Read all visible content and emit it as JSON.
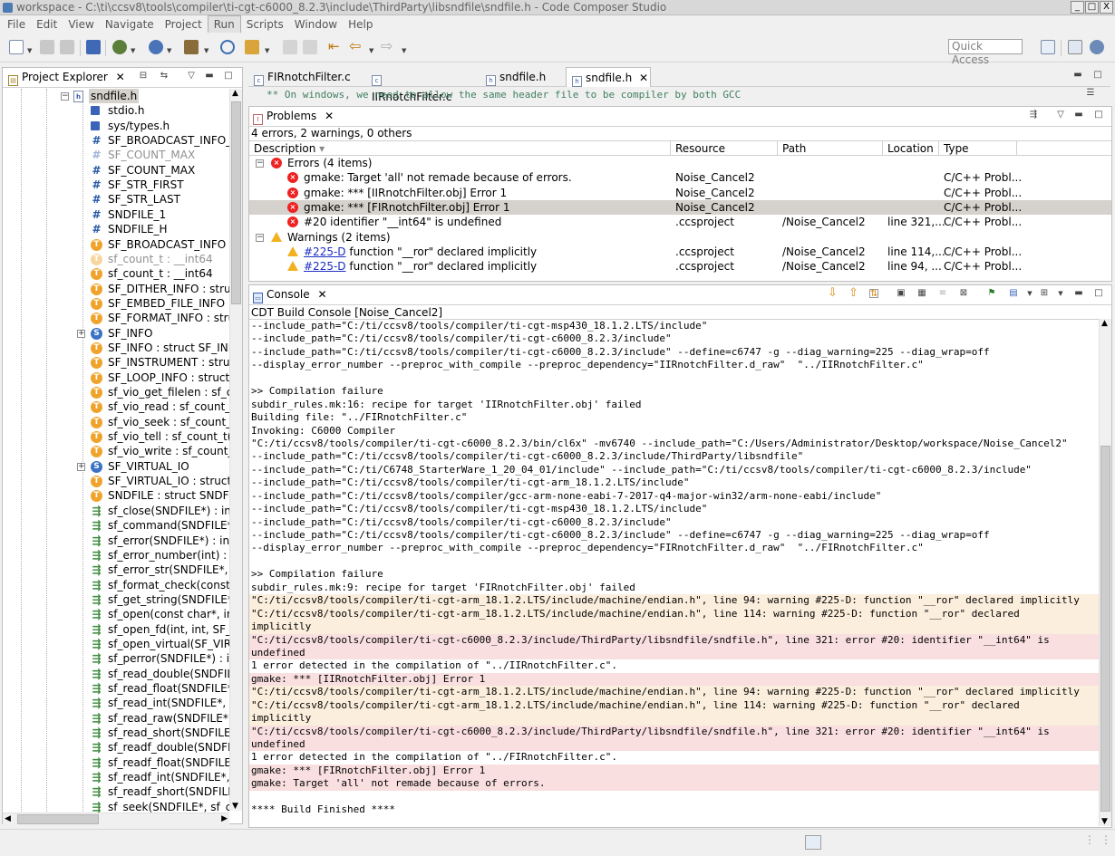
{
  "window": {
    "title": "workspace - C:\\ti\\ccsv8\\tools\\compiler\\ti-cgt-c6000_8.2.3\\include\\ThirdParty\\libsndfile\\sndfile.h - Code Composer Studio",
    "controls": [
      "_",
      "□",
      "X"
    ]
  },
  "menubar": {
    "items": [
      "File",
      "Edit",
      "View",
      "Navigate",
      "Project",
      "Run",
      "Scripts",
      "Window",
      "Help"
    ]
  },
  "toolbar": {
    "quick_access_placeholder": "Quick Access"
  },
  "project_explorer": {
    "title": "Project Explorer",
    "close": "✕",
    "items": [
      {
        "label": "sndfile.h",
        "icon": "header-file-icon",
        "indent": 0,
        "expander": "⊟",
        "selected": true
      },
      {
        "label": "stdio.h",
        "icon": "include-icon",
        "indent": 1
      },
      {
        "label": "sys/types.h",
        "icon": "include-icon",
        "indent": 1
      },
      {
        "label": "SF_BROADCAST_INFO_V",
        "icon": "macro-icon",
        "indent": 1
      },
      {
        "label": "SF_COUNT_MAX",
        "icon": "macro-icon",
        "indent": 1,
        "muted": true
      },
      {
        "label": "SF_COUNT_MAX",
        "icon": "macro-icon",
        "indent": 1
      },
      {
        "label": "SF_STR_FIRST",
        "icon": "macro-icon",
        "indent": 1
      },
      {
        "label": "SF_STR_LAST",
        "icon": "macro-icon",
        "indent": 1
      },
      {
        "label": "SNDFILE_1",
        "icon": "macro-icon",
        "indent": 1
      },
      {
        "label": "SNDFILE_H",
        "icon": "macro-icon",
        "indent": 1
      },
      {
        "label": "SF_BROADCAST_INFO :",
        "icon": "typedef-icon",
        "indent": 1
      },
      {
        "label": "sf_count_t : __int64",
        "icon": "typedef-icon",
        "indent": 1,
        "muted": true
      },
      {
        "label": "sf_count_t : __int64",
        "icon": "typedef-icon",
        "indent": 1
      },
      {
        "label": "SF_DITHER_INFO : struc",
        "icon": "typedef-icon",
        "indent": 1
      },
      {
        "label": "SF_EMBED_FILE_INFO :",
        "icon": "typedef-icon",
        "indent": 1
      },
      {
        "label": "SF_FORMAT_INFO : stru",
        "icon": "typedef-icon",
        "indent": 1
      },
      {
        "label": "SF_INFO",
        "icon": "struct-icon",
        "indent": 1,
        "expander": "⊞"
      },
      {
        "label": "SF_INFO : struct SF_INF",
        "icon": "typedef-icon",
        "indent": 1
      },
      {
        "label": "SF_INSTRUMENT : struc",
        "icon": "typedef-icon",
        "indent": 1
      },
      {
        "label": "SF_LOOP_INFO : struct",
        "icon": "typedef-icon",
        "indent": 1
      },
      {
        "label": "sf_vio_get_filelen : sf_co",
        "icon": "typedef-icon",
        "indent": 1
      },
      {
        "label": "sf_vio_read : sf_count_t(",
        "icon": "typedef-icon",
        "indent": 1
      },
      {
        "label": "sf_vio_seek : sf_count_t(",
        "icon": "typedef-icon",
        "indent": 1
      },
      {
        "label": "sf_vio_tell : sf_count_t(*)",
        "icon": "typedef-icon",
        "indent": 1
      },
      {
        "label": "sf_vio_write : sf_count_t(",
        "icon": "typedef-icon",
        "indent": 1
      },
      {
        "label": "SF_VIRTUAL_IO",
        "icon": "struct-icon",
        "indent": 1,
        "expander": "⊞"
      },
      {
        "label": "SF_VIRTUAL_IO : struct S",
        "icon": "typedef-icon",
        "indent": 1
      },
      {
        "label": "SNDFILE : struct SNDFIL",
        "icon": "typedef-icon",
        "indent": 1
      },
      {
        "label": "sf_close(SNDFILE*) : int",
        "icon": "function-icon",
        "indent": 1
      },
      {
        "label": "sf_command(SNDFILE*,",
        "icon": "function-icon",
        "indent": 1
      },
      {
        "label": "sf_error(SNDFILE*) : int",
        "icon": "function-icon",
        "indent": 1
      },
      {
        "label": "sf_error_number(int) : co",
        "icon": "function-icon",
        "indent": 1
      },
      {
        "label": "sf_error_str(SNDFILE*, c",
        "icon": "function-icon",
        "indent": 1
      },
      {
        "label": "sf_format_check(const S",
        "icon": "function-icon",
        "indent": 1
      },
      {
        "label": "sf_get_string(SNDFILE*,",
        "icon": "function-icon",
        "indent": 1
      },
      {
        "label": "sf_open(const char*, int,",
        "icon": "function-icon",
        "indent": 1
      },
      {
        "label": "sf_open_fd(int, int, SF_IN",
        "icon": "function-icon",
        "indent": 1
      },
      {
        "label": "sf_open_virtual(SF_VIRTU",
        "icon": "function-icon",
        "indent": 1
      },
      {
        "label": "sf_perror(SNDFILE*) : in",
        "icon": "function-icon",
        "indent": 1
      },
      {
        "label": "sf_read_double(SNDFILE",
        "icon": "function-icon",
        "indent": 1
      },
      {
        "label": "sf_read_float(SNDFILE*,",
        "icon": "function-icon",
        "indent": 1
      },
      {
        "label": "sf_read_int(SNDFILE*, in",
        "icon": "function-icon",
        "indent": 1
      },
      {
        "label": "sf_read_raw(SNDFILE*, v",
        "icon": "function-icon",
        "indent": 1
      },
      {
        "label": "sf_read_short(SNDFILE*,",
        "icon": "function-icon",
        "indent": 1
      },
      {
        "label": "sf_readf_double(SNDFILE",
        "icon": "function-icon",
        "indent": 1
      },
      {
        "label": "sf_readf_float(SNDFILE*,",
        "icon": "function-icon",
        "indent": 1
      },
      {
        "label": "sf_readf_int(SNDFILE*, in",
        "icon": "function-icon",
        "indent": 1
      },
      {
        "label": "sf_readf_short(SNDFILE*",
        "icon": "function-icon",
        "indent": 1
      },
      {
        "label": "sf_seek(SNDFILE*, sf_co",
        "icon": "function-icon",
        "indent": 1
      }
    ]
  },
  "editor": {
    "tabs": [
      {
        "label": "FIRnotchFilter.c",
        "icon": "c-file-icon",
        "active": false
      },
      {
        "label": "IIRnotchFilter.c",
        "icon": "c-file-icon",
        "active": false
      },
      {
        "label": "sndfile.h",
        "icon": "header-file-icon",
        "active": false
      },
      {
        "label": "sndfile.h",
        "icon": "header-file-icon",
        "active": true,
        "close": "✕"
      }
    ],
    "visible_line": "** On windows, we need to allow the same header file to be compiler by both GCC"
  },
  "problems": {
    "title": "Problems",
    "close": "✕",
    "summary": "4 errors, 2 warnings, 0 others",
    "columns": [
      "Description",
      "Resource",
      "Path",
      "Location",
      "Type"
    ],
    "sort_indicator": "▾",
    "groups": [
      {
        "label": "Errors (4 items)",
        "kind": "error",
        "rows": [
          {
            "desc_link": "",
            "desc": "gmake: Target 'all' not remade because of errors.",
            "resource": "Noise_Cancel2",
            "path": "",
            "location": "",
            "type": "C/C++ Probl..."
          },
          {
            "desc_link": "",
            "desc": "gmake: *** [IIRnotchFilter.obj] Error 1",
            "resource": "Noise_Cancel2",
            "path": "",
            "location": "",
            "type": "C/C++ Probl..."
          },
          {
            "desc_link": "",
            "desc": "gmake: *** [FIRnotchFilter.obj] Error 1",
            "resource": "Noise_Cancel2",
            "path": "",
            "location": "",
            "type": "C/C++ Probl...",
            "selected": true
          },
          {
            "desc_link": "",
            "desc": "#20 identifier \"__int64\" is undefined",
            "resource": ".ccsproject",
            "path": "/Noise_Cancel2",
            "location": "line 321,...",
            "type": "C/C++ Probl..."
          }
        ]
      },
      {
        "label": "Warnings (2 items)",
        "kind": "warning",
        "rows": [
          {
            "desc_link": "#225-D",
            "desc": " function \"__ror\" declared implicitly",
            "resource": ".ccsproject",
            "path": "/Noise_Cancel2",
            "location": "line 114,...",
            "type": "C/C++ Probl..."
          },
          {
            "desc_link": "#225-D",
            "desc": " function \"__ror\" declared implicitly",
            "resource": ".ccsproject",
            "path": "/Noise_Cancel2",
            "location": "line 94, ...",
            "type": "C/C++ Probl..."
          }
        ]
      }
    ]
  },
  "console": {
    "title": "Console",
    "close": "✕",
    "subtitle": "CDT Build Console [Noise_Cancel2]",
    "lines": [
      {
        "text": "--include_path=\"C:/ti/ccsv8/tools/compiler/ti-cgt-msp430_18.1.2.LTS/include\"",
        "kind": "normal"
      },
      {
        "text": "--include_path=\"C:/ti/ccsv8/tools/compiler/ti-cgt-c6000_8.2.3/include\"",
        "kind": "normal"
      },
      {
        "text": "--include_path=\"C:/ti/ccsv8/tools/compiler/ti-cgt-c6000_8.2.3/include\" --define=c6747 -g --diag_warning=225 --diag_wrap=off",
        "kind": "normal"
      },
      {
        "text": "--display_error_number --preproc_with_compile --preproc_dependency=\"IIRnotchFilter.d_raw\"  \"../IIRnotchFilter.c\"",
        "kind": "normal"
      },
      {
        "text": "",
        "kind": "normal"
      },
      {
        "text": ">> Compilation failure",
        "kind": "normal"
      },
      {
        "text": "subdir_rules.mk:16: recipe for target 'IIRnotchFilter.obj' failed",
        "kind": "normal"
      },
      {
        "text": "Building file: \"../FIRnotchFilter.c\"",
        "kind": "normal"
      },
      {
        "text": "Invoking: C6000 Compiler",
        "kind": "normal"
      },
      {
        "text": "\"C:/ti/ccsv8/tools/compiler/ti-cgt-c6000_8.2.3/bin/cl6x\" -mv6740 --include_path=\"C:/Users/Administrator/Desktop/workspace/Noise_Cancel2\"",
        "kind": "normal"
      },
      {
        "text": "--include_path=\"C:/ti/ccsv8/tools/compiler/ti-cgt-c6000_8.2.3/include/ThirdParty/libsndfile\"",
        "kind": "normal"
      },
      {
        "text": "--include_path=\"C:/ti/C6748_StarterWare_1_20_04_01/include\" --include_path=\"C:/ti/ccsv8/tools/compiler/ti-cgt-c6000_8.2.3/include\"",
        "kind": "normal"
      },
      {
        "text": "--include_path=\"C:/ti/ccsv8/tools/compiler/ti-cgt-arm_18.1.2.LTS/include\"",
        "kind": "normal"
      },
      {
        "text": "--include_path=\"C:/ti/ccsv8/tools/compiler/gcc-arm-none-eabi-7-2017-q4-major-win32/arm-none-eabi/include\"",
        "kind": "normal"
      },
      {
        "text": "--include_path=\"C:/ti/ccsv8/tools/compiler/ti-cgt-msp430_18.1.2.LTS/include\"",
        "kind": "normal"
      },
      {
        "text": "--include_path=\"C:/ti/ccsv8/tools/compiler/ti-cgt-c6000_8.2.3/include\"",
        "kind": "normal"
      },
      {
        "text": "--include_path=\"C:/ti/ccsv8/tools/compiler/ti-cgt-c6000_8.2.3/include\" --define=c6747 -g --diag_warning=225 --diag_wrap=off",
        "kind": "normal"
      },
      {
        "text": "--display_error_number --preproc_with_compile --preproc_dependency=\"FIRnotchFilter.d_raw\"  \"../FIRnotchFilter.c\"",
        "kind": "normal"
      },
      {
        "text": "",
        "kind": "normal"
      },
      {
        "text": ">> Compilation failure",
        "kind": "normal"
      },
      {
        "text": "subdir_rules.mk:9: recipe for target 'FIRnotchFilter.obj' failed",
        "kind": "normal"
      },
      {
        "text": "\"C:/ti/ccsv8/tools/compiler/ti-cgt-arm_18.1.2.LTS/include/machine/endian.h\", line 94: warning #225-D: function \"__ror\" declared implicitly",
        "kind": "warn"
      },
      {
        "text": "\"C:/ti/ccsv8/tools/compiler/ti-cgt-arm_18.1.2.LTS/include/machine/endian.h\", line 114: warning #225-D: function \"__ror\" declared",
        "kind": "warn"
      },
      {
        "text": "implicitly",
        "kind": "warn"
      },
      {
        "text": "\"C:/ti/ccsv8/tools/compiler/ti-cgt-c6000_8.2.3/include/ThirdParty/libsndfile/sndfile.h\", line 321: error #20: identifier \"__int64\" is",
        "kind": "err"
      },
      {
        "text": "undefined",
        "kind": "err"
      },
      {
        "text": "1 error detected in the compilation of \"../IIRnotchFilter.c\".",
        "kind": "normal"
      },
      {
        "text": "gmake: *** [IIRnotchFilter.obj] Error 1",
        "kind": "err"
      },
      {
        "text": "\"C:/ti/ccsv8/tools/compiler/ti-cgt-arm_18.1.2.LTS/include/machine/endian.h\", line 94: warning #225-D: function \"__ror\" declared implicitly",
        "kind": "warn"
      },
      {
        "text": "\"C:/ti/ccsv8/tools/compiler/ti-cgt-arm_18.1.2.LTS/include/machine/endian.h\", line 114: warning #225-D: function \"__ror\" declared",
        "kind": "warn"
      },
      {
        "text": "implicitly",
        "kind": "warn"
      },
      {
        "text": "\"C:/ti/ccsv8/tools/compiler/ti-cgt-c6000_8.2.3/include/ThirdParty/libsndfile/sndfile.h\", line 321: error #20: identifier \"__int64\" is",
        "kind": "err"
      },
      {
        "text": "undefined",
        "kind": "err"
      },
      {
        "text": "1 error detected in the compilation of \"../FIRnotchFilter.c\".",
        "kind": "normal"
      },
      {
        "text": "gmake: *** [FIRnotchFilter.obj] Error 1",
        "kind": "err"
      },
      {
        "text": "gmake: Target 'all' not remade because of errors.",
        "kind": "err"
      },
      {
        "text": "",
        "kind": "normal"
      },
      {
        "text": "**** Build Finished ****",
        "kind": "normal"
      }
    ]
  },
  "colors": {
    "warning_bg": "#fbeedc",
    "error_bg": "#f9dfdf",
    "selection": "#d5d1cc",
    "link": "#1d2ec5"
  }
}
